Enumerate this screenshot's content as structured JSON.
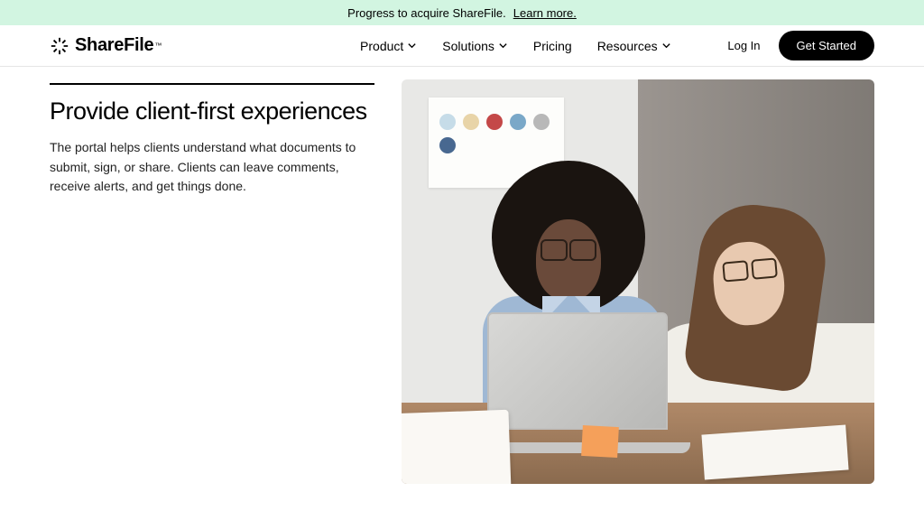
{
  "banner": {
    "text": "Progress to acquire ShareFile.",
    "link": "Learn more."
  },
  "logo": {
    "name": "ShareFile"
  },
  "nav": {
    "items": [
      {
        "label": "Product",
        "dropdown": true
      },
      {
        "label": "Solutions",
        "dropdown": true
      },
      {
        "label": "Pricing",
        "dropdown": false
      },
      {
        "label": "Resources",
        "dropdown": true
      }
    ]
  },
  "actions": {
    "login": "Log In",
    "cta": "Get Started"
  },
  "main": {
    "heading": "Provide client-first experiences",
    "body": "The portal helps clients understand what documents to submit, sign, or share. Clients can leave comments, receive alerts, and get things done."
  }
}
